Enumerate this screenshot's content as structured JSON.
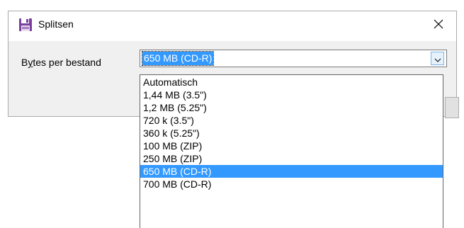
{
  "window": {
    "title": "Splitsen",
    "close_glyph": "✕"
  },
  "form": {
    "label": "Bytes per bestand",
    "label_prefix": "B",
    "label_underlined": "y",
    "label_rest": "tes per bestand",
    "selected_value": "650 MB (CD-R)"
  },
  "dropdown": {
    "options": [
      "Automatisch",
      "1,44 MB (3.5\")",
      "1,2 MB (5.25\")",
      "720 k (3.5\")",
      "360 k (5.25\")",
      "100 MB (ZIP)",
      "250 MB (ZIP)",
      "650 MB (CD-R)",
      "700 MB (CD-R)"
    ],
    "selected_index": 7
  },
  "icons": {
    "app": "floppy-disk-icon",
    "close": "close-icon",
    "dropdown": "chevron-down-icon"
  },
  "colors": {
    "selection": "#3399ff",
    "floppy": "#7b3fa0"
  }
}
